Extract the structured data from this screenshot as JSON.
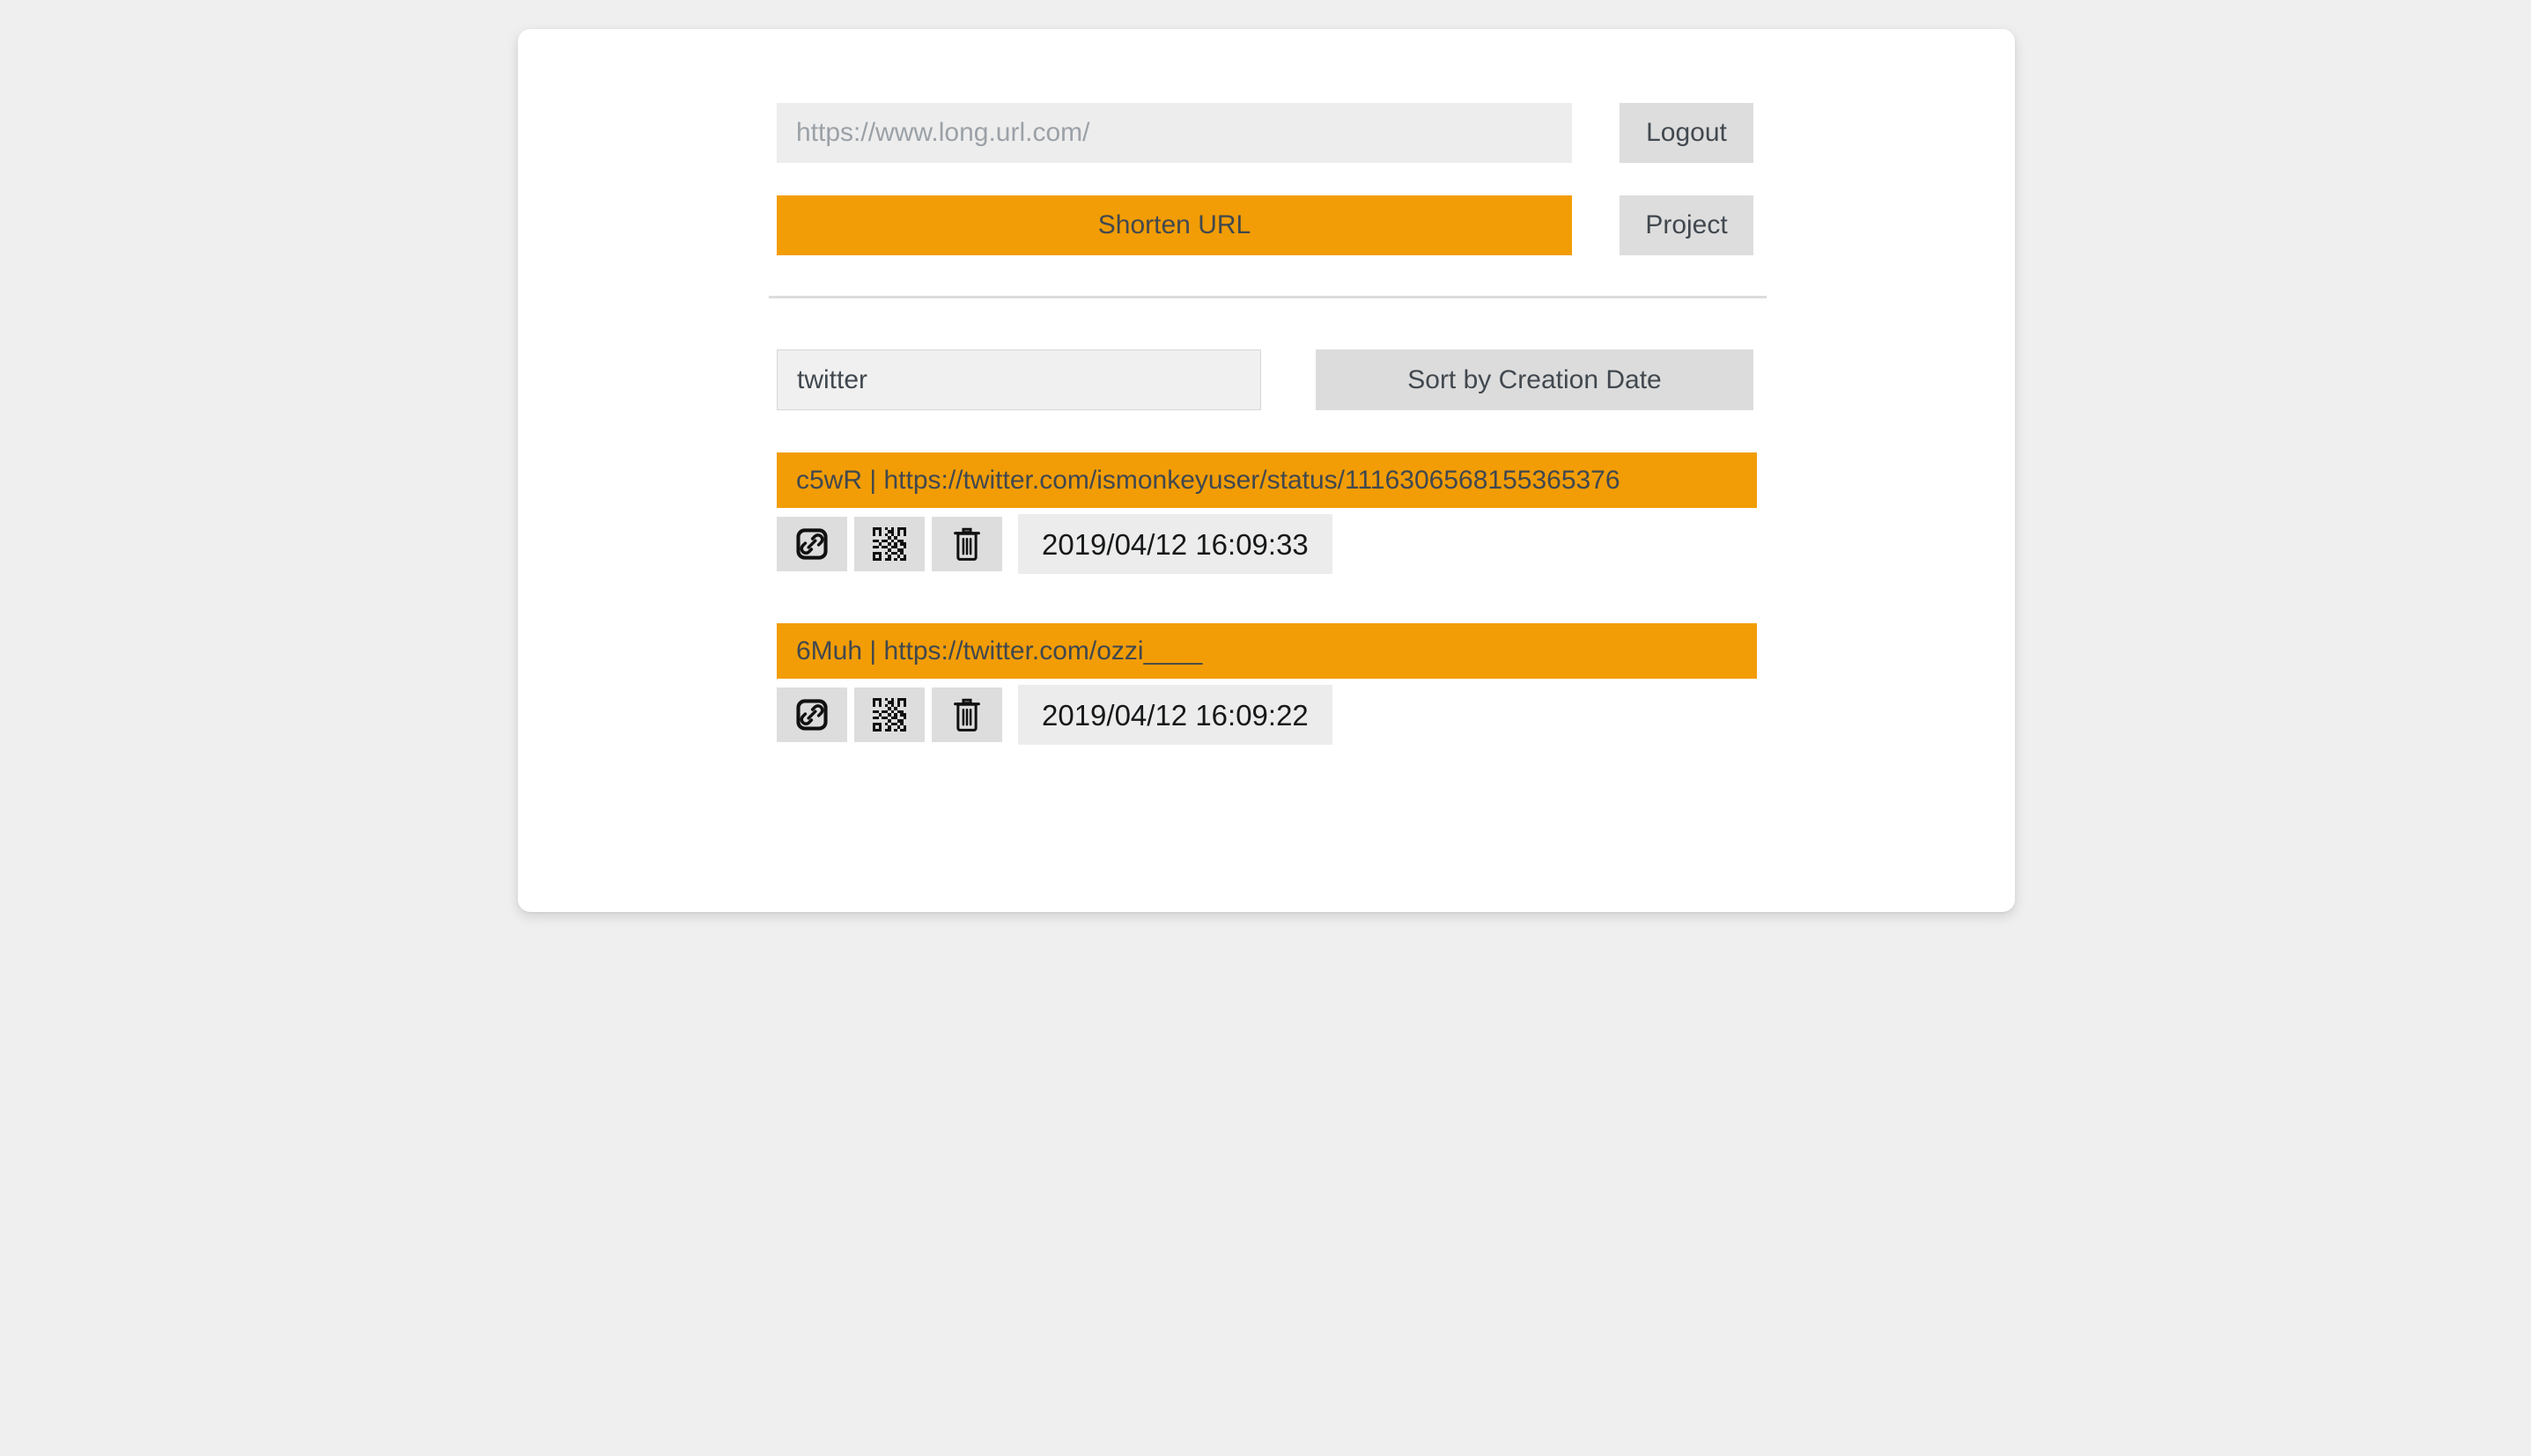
{
  "app": {
    "accent_color": "#f29d05",
    "text_color": "#41484f",
    "button_bg": "#dddddd",
    "card_bg": "#ffffff",
    "page_bg": "#efefef"
  },
  "shorten": {
    "url_placeholder": "https://www.long.url.com/",
    "url_value": "",
    "submit_label": "Shorten URL",
    "logout_label": "Logout",
    "project_label": "Project"
  },
  "filter": {
    "search_value": "twitter",
    "search_placeholder": "",
    "sort_label": "Sort by Creation Date"
  },
  "icons": {
    "edit_link": "edit-link-icon",
    "qr_code": "qr-code-icon",
    "delete": "trash-icon"
  },
  "results": [
    {
      "slug": "c5wR",
      "separator": "|",
      "url": "https://twitter.com/ismonkeyuser/status/1116306568155365376",
      "label": "c5wR | https://twitter.com/ismonkeyuser/status/1116306568155365376",
      "created_at": "2019/04/12 16:09:33"
    },
    {
      "slug": "6Muh",
      "separator": "|",
      "url": "https://twitter.com/ozzi____",
      "label": "6Muh | https://twitter.com/ozzi____",
      "created_at": "2019/04/12 16:09:22"
    }
  ]
}
